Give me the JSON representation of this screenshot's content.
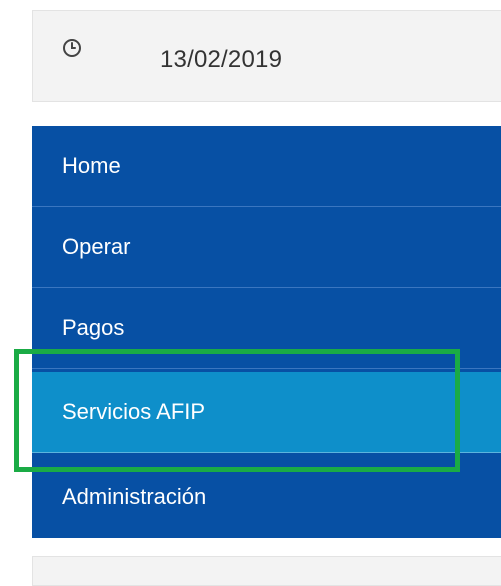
{
  "date_bar": {
    "icon": "clock-icon",
    "date": "13/02/2019"
  },
  "menu": {
    "items": [
      {
        "label": "Home"
      },
      {
        "label": "Operar"
      },
      {
        "label": "Pagos"
      },
      {
        "label": "Servicios AFIP"
      },
      {
        "label": "Administración"
      }
    ],
    "active_index": 3
  },
  "colors": {
    "menu_bg": "#0750a4",
    "active_bg": "#0e8fca",
    "highlight_border": "#1aab45",
    "bar_bg": "#f3f3f3"
  }
}
